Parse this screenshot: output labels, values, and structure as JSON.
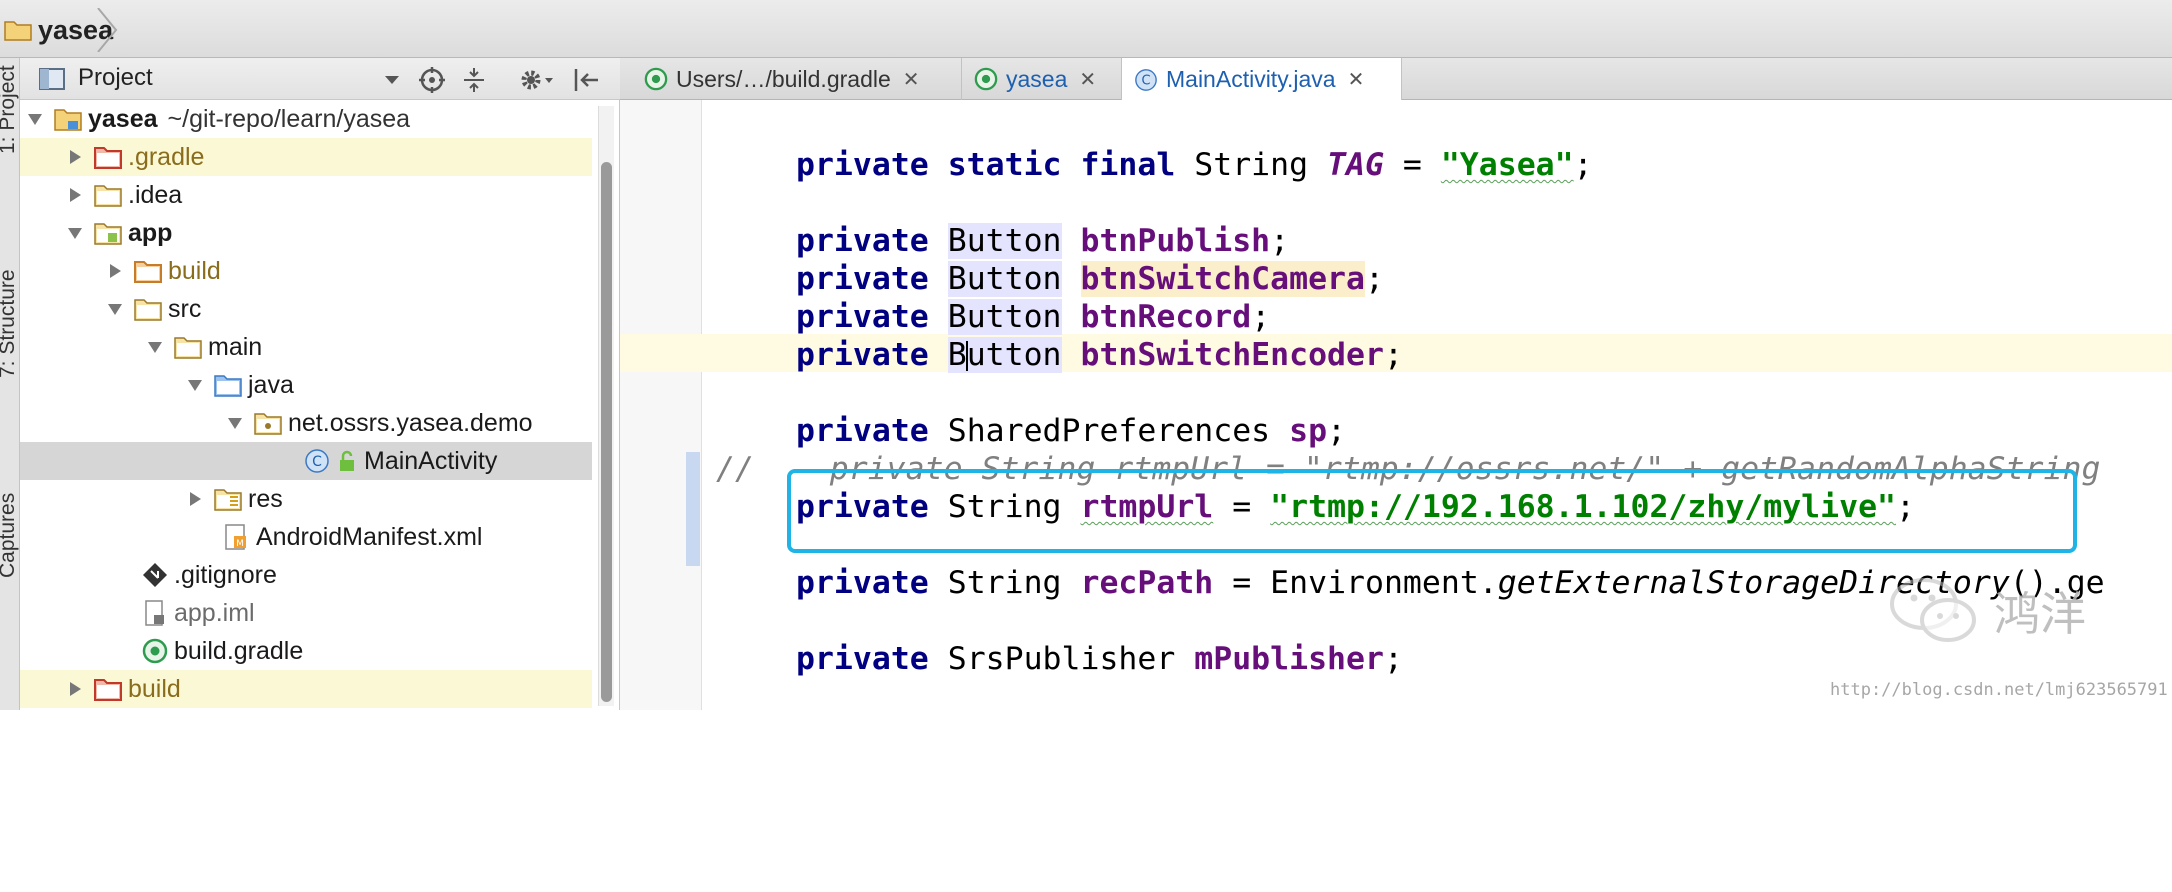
{
  "breadcrumb": {
    "label": "yasea"
  },
  "toolstrip": {
    "tabs": [
      "1: Project",
      "7: Structure",
      "Captures"
    ]
  },
  "project_panel": {
    "title": "Project",
    "tree": [
      {
        "label": "yasea",
        "path": "~/git-repo/learn/yasea",
        "depth": 0,
        "expanded": true,
        "icon": "module-folder-icon"
      },
      {
        "label": ".gradle",
        "depth": 1,
        "expanded": false,
        "icon": "excluded-folder-icon"
      },
      {
        "label": ".idea",
        "depth": 1,
        "expanded": false,
        "icon": "folder-icon"
      },
      {
        "label": "app",
        "depth": 1,
        "expanded": true,
        "icon": "android-module-icon"
      },
      {
        "label": "build",
        "depth": 2,
        "expanded": false,
        "icon": "excluded-folder-icon"
      },
      {
        "label": "src",
        "depth": 2,
        "expanded": true,
        "icon": "folder-icon"
      },
      {
        "label": "main",
        "depth": 3,
        "expanded": true,
        "icon": "folder-icon"
      },
      {
        "label": "java",
        "depth": 4,
        "expanded": true,
        "icon": "source-folder-icon"
      },
      {
        "label": "net.ossrs.yasea.demo",
        "depth": 5,
        "expanded": true,
        "icon": "package-icon"
      },
      {
        "label": "MainActivity",
        "depth": 6,
        "icon": "class-icon"
      },
      {
        "label": "res",
        "depth": 4,
        "expanded": false,
        "icon": "resource-folder-icon"
      },
      {
        "label": "AndroidManifest.xml",
        "depth": 4,
        "icon": "manifest-icon"
      },
      {
        "label": ".gitignore",
        "depth": 2,
        "icon": "gitignore-icon"
      },
      {
        "label": "app.iml",
        "depth": 2,
        "icon": "iml-file-icon"
      },
      {
        "label": "build.gradle",
        "depth": 2,
        "icon": "gradle-icon"
      },
      {
        "label": "build",
        "depth": 1,
        "expanded": false,
        "icon": "excluded-folder-icon"
      }
    ]
  },
  "editor_tabs": [
    {
      "label": "Users/…/build.gradle",
      "icon": "gradle-icon",
      "active": false
    },
    {
      "label": "yasea",
      "icon": "gradle-icon",
      "active": false
    },
    {
      "label": "MainActivity.java",
      "icon": "class-icon",
      "active": true
    }
  ],
  "code": {
    "line1": {
      "kw": "private static final",
      "type": "String",
      "name": "TAG",
      "eq": "=",
      "value": "\"Yasea\"",
      "end": ";"
    },
    "line2": {
      "kw": "private",
      "type": "Button",
      "name": "btnPublish",
      "end": ";"
    },
    "line3": {
      "kw": "private",
      "type": "Button",
      "name": "btnSwitchCamera",
      "end": ";"
    },
    "line4": {
      "kw": "private",
      "type": "Button",
      "name": "btnRecord",
      "end": ";"
    },
    "line5": {
      "kw": "private",
      "type_before_cursor": "B",
      "type_after_cursor": "utton",
      "name": "btnSwitchEncoder",
      "end": ";"
    },
    "line6": {
      "kw": "private",
      "type": "SharedPreferences",
      "name": "sp",
      "end": ";"
    },
    "line7_comment": "//    private String rtmpUrl = \"rtmp://ossrs.net/\" + getRandomAlphaString",
    "line8": {
      "kw": "private",
      "type": "String",
      "name": "rtmpUrl",
      "eq": "=",
      "value": "\"rtmp://192.168.1.102/zhy/mylive\"",
      "end": ";"
    },
    "line9": {
      "kw": "private",
      "type": "String",
      "name": "recPath",
      "eq": "=",
      "rest_plain": "Environment.",
      "method": "getExternalStorageDirectory",
      "tail": "().ge"
    },
    "line10": {
      "kw": "private",
      "type": "SrsPublisher",
      "name": "mPublisher",
      "end": ";"
    }
  },
  "watermark": {
    "text": "鸿洋",
    "url": "http://blog.csdn.net/lmj623565791"
  },
  "colors": {
    "keyword": "#000080",
    "field": "#660e7a",
    "string": "#008000",
    "comment": "#808080",
    "highlight_box": "#1fb3e6"
  }
}
